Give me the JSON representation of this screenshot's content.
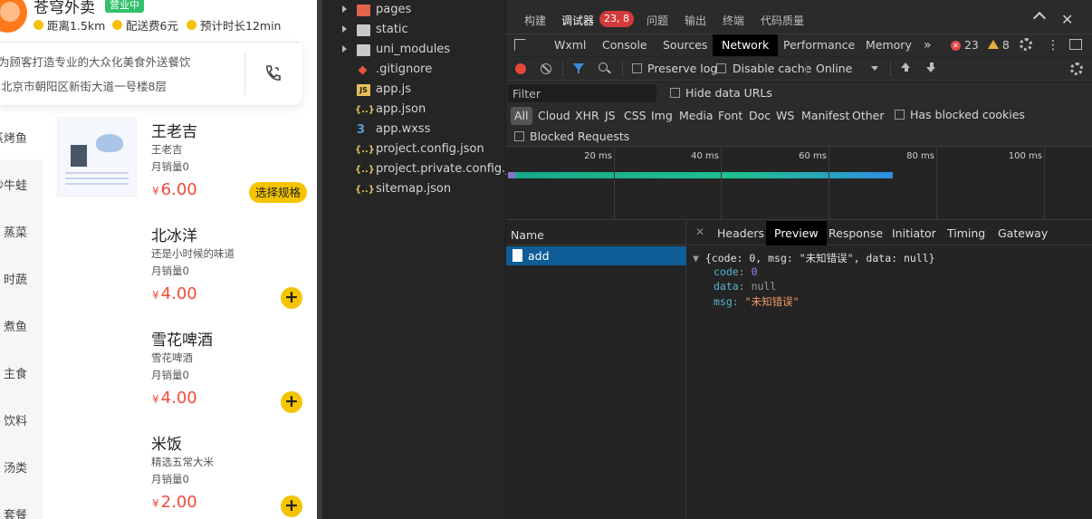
{
  "simulator": {
    "shop_name": "苍穹外卖",
    "status_badge": "营业中",
    "distance": "距离1.5km",
    "delivery_fee": "配送费6元",
    "eta": "预计时长12min",
    "description": "为顾客打造专业的大众化美食外送餐饮",
    "address": "北京市朝阳区新街大道一号楼8层",
    "categories": [
      "蒸烤鱼",
      "炒牛蛙",
      "蒸菜",
      "时蔬",
      "煮鱼",
      "主食",
      "饮料",
      "汤类",
      "套餐"
    ],
    "products": [
      {
        "name": "王老吉",
        "desc": "王老吉",
        "sold": "月销量0",
        "currency": "¥",
        "price": "6.00",
        "action": "选择规格"
      },
      {
        "name": "北冰洋",
        "desc": "还是小时候的味道",
        "sold": "月销量0",
        "currency": "¥",
        "price": "4.00",
        "action": "+"
      },
      {
        "name": "雪花啤酒",
        "desc": "雪花啤酒",
        "sold": "月销量0",
        "currency": "¥",
        "price": "4.00",
        "action": "+"
      },
      {
        "name": "米饭",
        "desc": "精选五常大米",
        "sold": "月销量0",
        "currency": "¥",
        "price": "2.00",
        "action": "+"
      }
    ]
  },
  "file_tree": [
    {
      "label": "pages",
      "icon": "folder-icon",
      "folder": true
    },
    {
      "label": "static",
      "icon": "folder-icon",
      "folder": true
    },
    {
      "label": "uni_modules",
      "icon": "folder-icon",
      "folder": true
    },
    {
      "label": ".gitignore",
      "icon": "git-icon",
      "folder": false
    },
    {
      "label": "app.js",
      "icon": "js-icon",
      "folder": false
    },
    {
      "label": "app.json",
      "icon": "json-icon",
      "folder": false
    },
    {
      "label": "app.wxss",
      "icon": "css-icon",
      "folder": false
    },
    {
      "label": "project.config.json",
      "icon": "json-icon",
      "folder": false
    },
    {
      "label": "project.private.config.js...",
      "icon": "json-icon",
      "folder": false
    },
    {
      "label": "sitemap.json",
      "icon": "json-icon",
      "folder": false
    }
  ],
  "devtools": {
    "top_tabs": [
      "构建",
      "调试器",
      "问题",
      "输出",
      "终端",
      "代码质量"
    ],
    "active_top_tab": "调试器",
    "debugger_badge": "23, 8",
    "panel_tabs": [
      "Wxml",
      "Console",
      "Sources",
      "Network",
      "Performance",
      "Memory"
    ],
    "active_panel_tab": "Network",
    "more_tabs": "»",
    "error_count": "23",
    "warning_count": "8",
    "toolbar": {
      "preserve_log": "Preserve log",
      "disable_cache": "Disable cache",
      "throttle": "Online"
    },
    "filter": {
      "placeholder": "Filter",
      "hide_data_urls": "Hide data URLs",
      "types": [
        "All",
        "Cloud",
        "XHR",
        "JS",
        "CSS",
        "Img",
        "Media",
        "Font",
        "Doc",
        "WS",
        "Manifest",
        "Other"
      ],
      "active_type": "All",
      "has_blocked_cookies": "Has blocked cookies",
      "blocked_requests": "Blocked Requests"
    },
    "timeline_ticks": [
      "20 ms",
      "40 ms",
      "60 ms",
      "80 ms",
      "100 ms"
    ],
    "name_header": "Name",
    "requests": [
      {
        "name": "add"
      }
    ],
    "detail_tabs": [
      "Headers",
      "Preview",
      "Response",
      "Initiator",
      "Timing",
      "Gateway"
    ],
    "active_detail_tab": "Preview",
    "preview": {
      "summary": "{code: 0, msg: \"未知错误\", data: null}",
      "fields": [
        {
          "key": "code",
          "value": "0",
          "type": "number"
        },
        {
          "key": "data",
          "value": "null",
          "type": "null"
        },
        {
          "key": "msg",
          "value": "\"未知错误\"",
          "type": "string"
        }
      ]
    },
    "colors": {
      "accent_blue": "#0f5d96",
      "error_red": "#d33b3b",
      "price_red": "#f24a3a",
      "button_yellow": "#f5c400"
    }
  }
}
